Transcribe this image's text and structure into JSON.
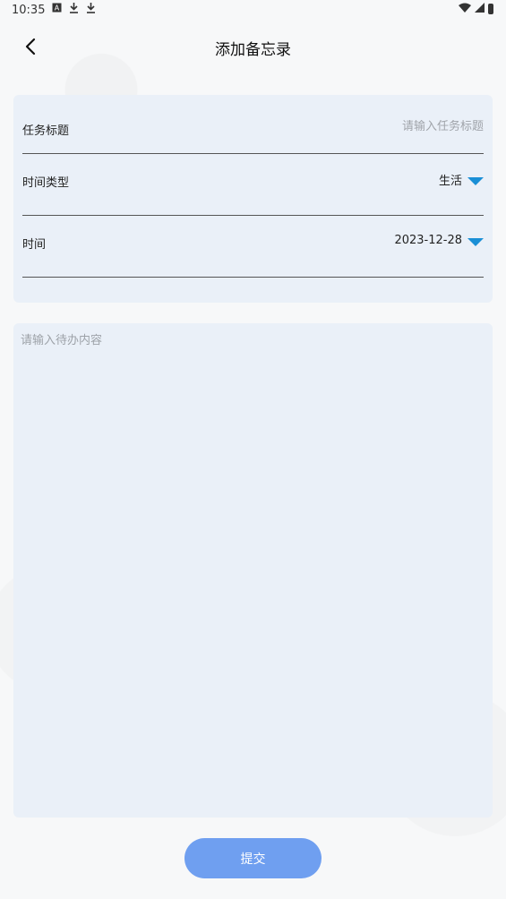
{
  "status_bar": {
    "time": "10:35",
    "left_icons": [
      "font-icon",
      "download-icon",
      "download-icon"
    ],
    "right_icons": [
      "wifi-icon",
      "signal-icon",
      "battery-icon"
    ]
  },
  "header": {
    "title": "添加备忘录"
  },
  "form": {
    "task_title": {
      "label": "任务标题",
      "placeholder": "请输入任务标题",
      "value": ""
    },
    "time_type": {
      "label": "时间类型",
      "value": "生活"
    },
    "time": {
      "label": "时间",
      "value": "2023-12-28"
    }
  },
  "content": {
    "placeholder": "请输入待办内容",
    "value": ""
  },
  "submit": {
    "label": "提交"
  },
  "colors": {
    "card_bg": "#eaf0f8",
    "accent": "#1a8fd6",
    "submit_bg": "#6f9ff0"
  }
}
